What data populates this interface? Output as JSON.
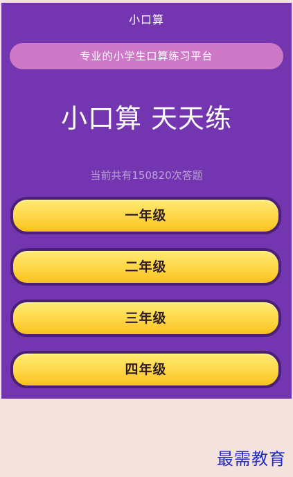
{
  "app": {
    "title": "小口算"
  },
  "header": {
    "tagline": "专业的小学生口算练习平台",
    "hero_title": "小口算 天天练",
    "answer_count_text": "当前共有150820次答题"
  },
  "grades": [
    {
      "label": "一年级"
    },
    {
      "label": "二年级"
    },
    {
      "label": "三年级"
    },
    {
      "label": "四年级"
    }
  ],
  "watermark": {
    "text": "最需教育"
  },
  "colors": {
    "primary_purple": "#7435b0",
    "tagline_pink": "#cd79c8",
    "button_yellow_top": "#ffea72",
    "button_yellow_bottom": "#f8c21d",
    "button_border": "#4b1f74",
    "footer_background": "#f3e2dd",
    "watermark_blue": "#1f28c9"
  }
}
